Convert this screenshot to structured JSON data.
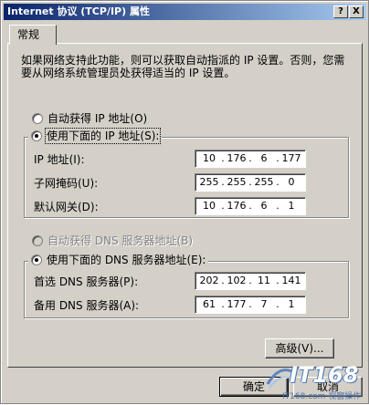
{
  "window": {
    "title": "Internet 协议 (TCP/IP) 属性",
    "help_glyph": "?",
    "close_glyph": "X"
  },
  "tabs": [
    {
      "label": "常规"
    }
  ],
  "description": "如果网络支持此功能，则可以获取自动指派的 IP 设置。否则，您需要从网络系统管理员处获得适当的 IP 设置。",
  "ip_section": {
    "auto_label": "自动获得 IP 地址(O)",
    "manual_label": "使用下面的 IP 地址(S):",
    "selected": "manual",
    "fields": [
      {
        "label": "IP 地址(I):",
        "octets": [
          "10",
          "176",
          "6",
          "177"
        ]
      },
      {
        "label": "子网掩码(U):",
        "octets": [
          "255",
          "255",
          "255",
          "0"
        ]
      },
      {
        "label": "默认网关(D):",
        "octets": [
          "10",
          "176",
          "6",
          "1"
        ]
      }
    ]
  },
  "dns_section": {
    "auto_label": "自动获得 DNS 服务器地址(B)",
    "manual_label": "使用下面的 DNS 服务器地址(E):",
    "selected": "manual",
    "auto_disabled": true,
    "fields": [
      {
        "label": "首选 DNS 服务器(P):",
        "octets": [
          "202",
          "102",
          "11",
          "141"
        ]
      },
      {
        "label": "备用 DNS 服务器(A):",
        "octets": [
          "61",
          "177",
          "7",
          "1"
        ]
      }
    ]
  },
  "buttons": {
    "advanced": "高级(V)...",
    "ok": "确定",
    "cancel": "取消"
  },
  "watermark": {
    "logo": "IT168",
    "url": "IT168.com 视窗操作"
  }
}
